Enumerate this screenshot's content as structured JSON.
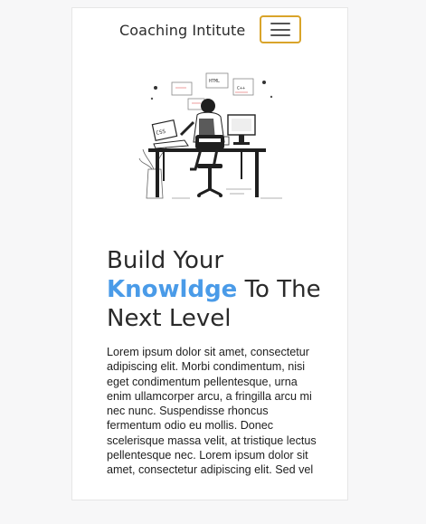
{
  "navbar": {
    "brand": "Coaching Intitute",
    "toggle_icon": "hamburger-menu-icon",
    "accent_color": "#d9a42a"
  },
  "hero": {
    "illustration_icon": "developer-at-desk-illustration",
    "illustration_labels": [
      "HTML",
      "CSS",
      "C++"
    ],
    "title_part1": "Build Your",
    "title_accent": "Knowldge",
    "title_part2": " To The Next Level",
    "accent_color": "#4a9be8",
    "paragraph": "Lorem ipsum dolor sit amet, consectetur adipiscing elit. Morbi condimentum, nisi eget condimentum pellentesque, urna enim ullamcorper arcu, a fringilla arcu mi nec nunc. Suspendisse rhoncus fermentum odio eu mollis. Donec scelerisque massa velit, at tristique lectus pellentesque nec. Lorem ipsum dolor sit amet, consectetur adipiscing elit. Sed vel"
  }
}
